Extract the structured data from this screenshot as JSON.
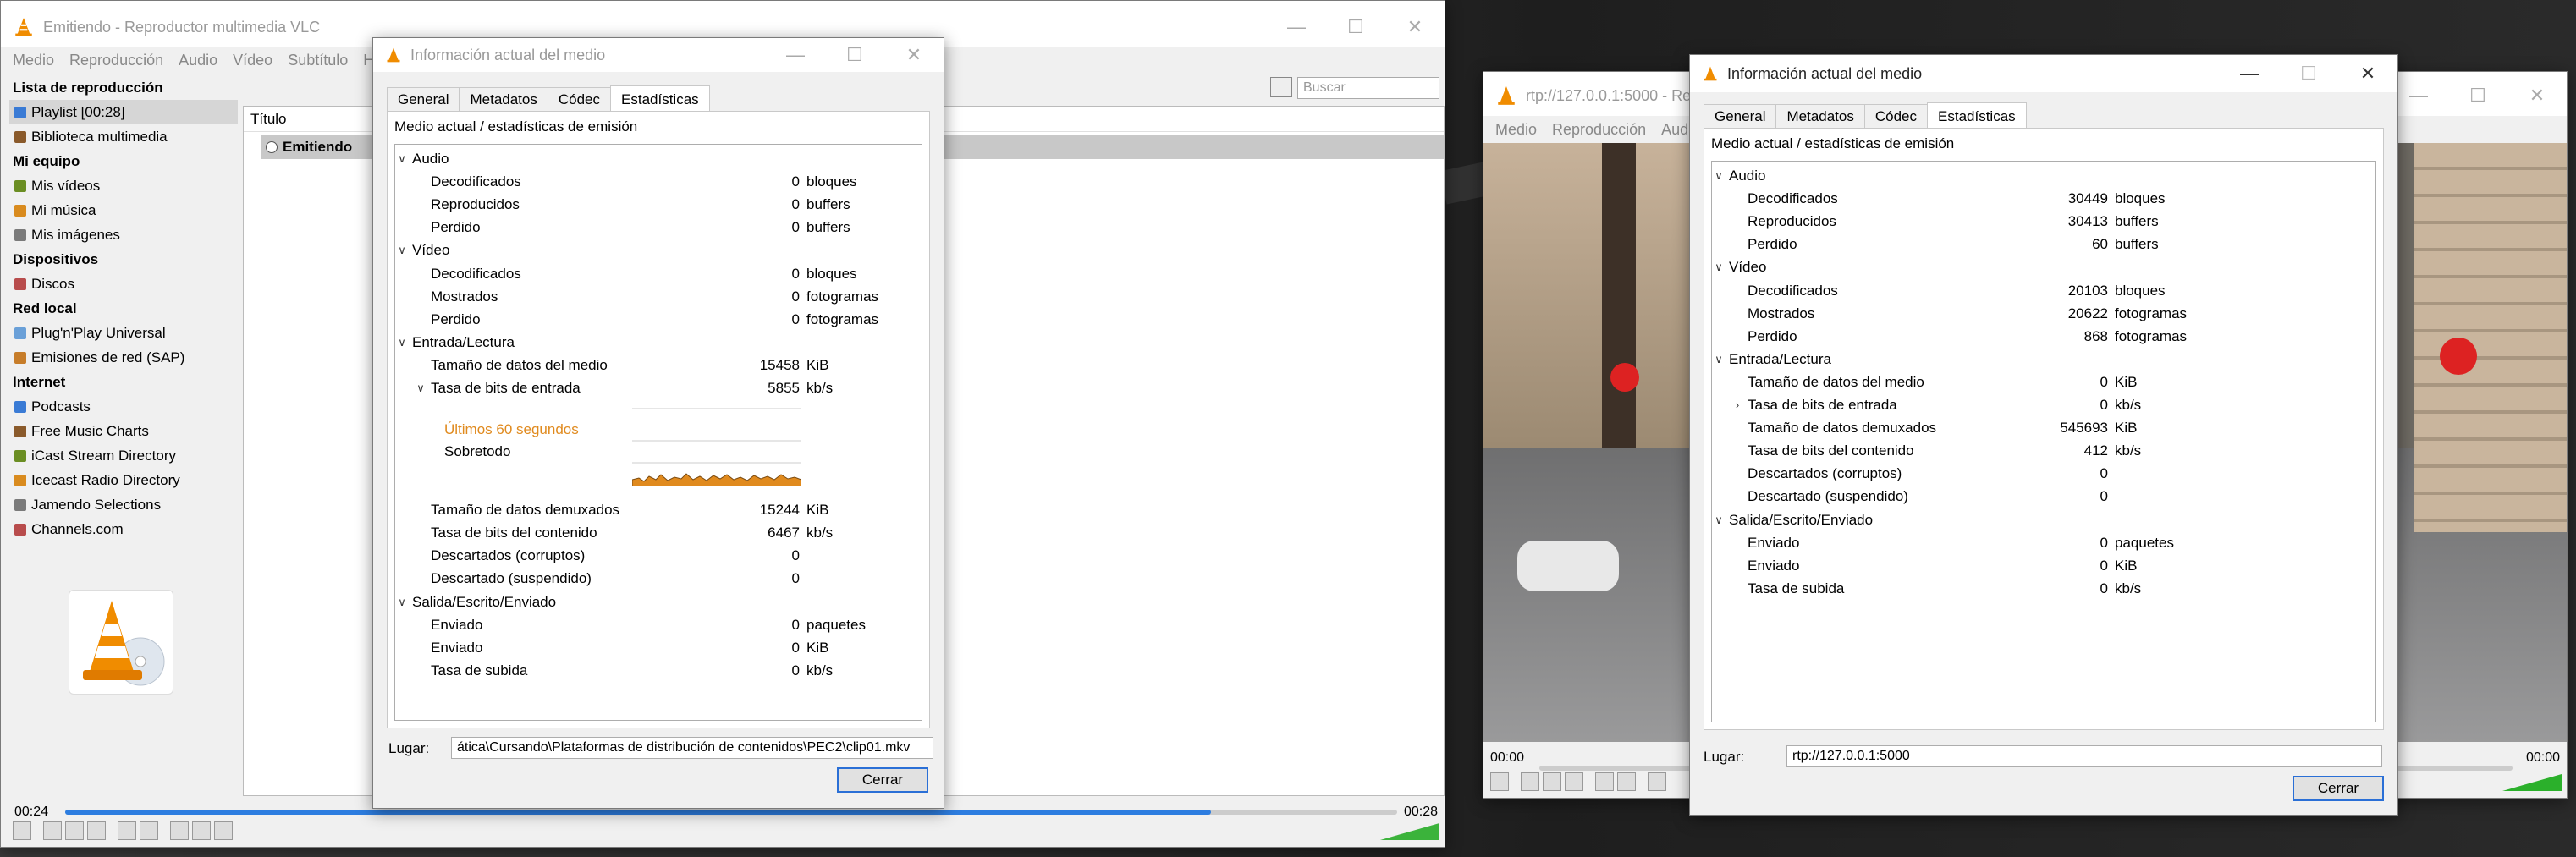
{
  "vlc_main": {
    "title": "Emitiendo - Reproductor multimedia VLC",
    "menu": [
      "Medio",
      "Reproducción",
      "Audio",
      "Vídeo",
      "Subtítulo",
      "H"
    ],
    "search_placeholder": "Buscar",
    "sidebar": {
      "sections": [
        {
          "title": "Lista de reproducción",
          "items": [
            "Playlist [00:28]",
            "Biblioteca multimedia"
          ]
        },
        {
          "title": "Mi equipo",
          "items": [
            "Mis vídeos",
            "Mi música",
            "Mis imágenes"
          ]
        },
        {
          "title": "Dispositivos",
          "items": [
            "Discos"
          ]
        },
        {
          "title": "Red local",
          "items": [
            "Plug'n'Play Universal",
            "Emisiones de red (SAP)"
          ]
        },
        {
          "title": "Internet",
          "items": [
            "Podcasts",
            "Free Music Charts",
            "iCast Stream Directory",
            "Icecast Radio Directory",
            "Jamendo Selections",
            "Channels.com"
          ]
        }
      ]
    },
    "list_header": "Título",
    "list_row": "Emitiendo",
    "time_elapsed": "00:24",
    "time_total": "00:28",
    "progress": 0.86,
    "volume_label": "100%"
  },
  "dialog1": {
    "title": "Información actual del medio",
    "tabs": [
      "General",
      "Metadatos",
      "Códec",
      "Estadísticas"
    ],
    "active_tab": "Estadísticas",
    "caption": "Medio actual / estadísticas de emisión",
    "rows": [
      {
        "label": "Audio",
        "level": 0,
        "caret": "v"
      },
      {
        "label": "Decodificados",
        "level": 1,
        "value": "0",
        "unit": "bloques"
      },
      {
        "label": "Reproducidos",
        "level": 1,
        "value": "0",
        "unit": "buffers"
      },
      {
        "label": "Perdido",
        "level": 1,
        "value": "0",
        "unit": "buffers"
      },
      {
        "label": "Vídeo",
        "level": 0,
        "caret": "v"
      },
      {
        "label": "Decodificados",
        "level": 1,
        "value": "0",
        "unit": "bloques"
      },
      {
        "label": "Mostrados",
        "level": 1,
        "value": "0",
        "unit": "fotogramas"
      },
      {
        "label": "Perdido",
        "level": 1,
        "value": "0",
        "unit": "fotogramas"
      },
      {
        "label": "Entrada/Lectura",
        "level": 0,
        "caret": "v"
      },
      {
        "label": "Tamaño de datos del medio",
        "level": 1,
        "value": "15458",
        "unit": "KiB"
      },
      {
        "label": "Tasa de bits de entrada",
        "level": 1,
        "value": "5855",
        "unit": "kb/s",
        "caret": "v"
      }
    ],
    "graph": {
      "last_label": "Últimos 60 segundos",
      "overlay_label": "Sobretodo"
    },
    "rows2": [
      {
        "label": "Tamaño de datos demuxados",
        "level": 1,
        "value": "15244",
        "unit": "KiB"
      },
      {
        "label": "Tasa de bits del contenido",
        "level": 1,
        "value": "6467",
        "unit": "kb/s"
      },
      {
        "label": "Descartados (corruptos)",
        "level": 1,
        "value": "0",
        "unit": ""
      },
      {
        "label": "Descartado (suspendido)",
        "level": 1,
        "value": "0",
        "unit": ""
      },
      {
        "label": "Salida/Escrito/Enviado",
        "level": 0,
        "caret": "v"
      },
      {
        "label": "Enviado",
        "level": 1,
        "value": "0",
        "unit": "paquetes"
      },
      {
        "label": "Enviado",
        "level": 1,
        "value": "0",
        "unit": "KiB"
      },
      {
        "label": "Tasa de subida",
        "level": 1,
        "value": "0",
        "unit": "kb/s"
      }
    ],
    "location_label": "Lugar:",
    "location_value": "ática\\Cursando\\Plataformas de distribución de contenidos\\PEC2\\clip01.mkv",
    "close_label": "Cerrar"
  },
  "vlc_second": {
    "title": "rtp://127.0.0.1:5000 - Rep",
    "menu": [
      "Medio",
      "Reproducción",
      "Audi"
    ],
    "time_elapsed": "00:00",
    "time_total": "00:00",
    "volume_label": "100%"
  },
  "dialog2": {
    "title": "Información actual del medio",
    "tabs": [
      "General",
      "Metadatos",
      "Códec",
      "Estadísticas"
    ],
    "active_tab": "Estadísticas",
    "caption": "Medio actual / estadísticas de emisión",
    "rows": [
      {
        "label": "Audio",
        "level": 0,
        "caret": "v"
      },
      {
        "label": "Decodificados",
        "level": 1,
        "value": "30449",
        "unit": "bloques"
      },
      {
        "label": "Reproducidos",
        "level": 1,
        "value": "30413",
        "unit": "buffers"
      },
      {
        "label": "Perdido",
        "level": 1,
        "value": "60",
        "unit": "buffers"
      },
      {
        "label": "Vídeo",
        "level": 0,
        "caret": "v"
      },
      {
        "label": "Decodificados",
        "level": 1,
        "value": "20103",
        "unit": "bloques"
      },
      {
        "label": "Mostrados",
        "level": 1,
        "value": "20622",
        "unit": "fotogramas"
      },
      {
        "label": "Perdido",
        "level": 1,
        "value": "868",
        "unit": "fotogramas"
      },
      {
        "label": "Entrada/Lectura",
        "level": 0,
        "caret": "v"
      },
      {
        "label": "Tamaño de datos del medio",
        "level": 1,
        "value": "0",
        "unit": "KiB"
      },
      {
        "label": "Tasa de bits de entrada",
        "level": 1,
        "value": "0",
        "unit": "kb/s",
        "caret": ">"
      },
      {
        "label": "Tamaño de datos demuxados",
        "level": 1,
        "value": "545693",
        "unit": "KiB"
      },
      {
        "label": "Tasa de bits del contenido",
        "level": 1,
        "value": "412",
        "unit": "kb/s"
      },
      {
        "label": "Descartados (corruptos)",
        "level": 1,
        "value": "0",
        "unit": ""
      },
      {
        "label": "Descartado (suspendido)",
        "level": 1,
        "value": "0",
        "unit": ""
      },
      {
        "label": "Salida/Escrito/Enviado",
        "level": 0,
        "caret": "v"
      },
      {
        "label": "Enviado",
        "level": 1,
        "value": "0",
        "unit": "paquetes"
      },
      {
        "label": "Enviado",
        "level": 1,
        "value": "0",
        "unit": "KiB"
      },
      {
        "label": "Tasa de subida",
        "level": 1,
        "value": "0",
        "unit": "kb/s"
      }
    ],
    "location_label": "Lugar:",
    "location_value": "rtp://127.0.0.1:5000",
    "close_label": "Cerrar"
  },
  "colors": {
    "vlc_orange": "#f08c00",
    "accent_blue": "#2d7de0",
    "graph_orange": "#e08a1e"
  }
}
